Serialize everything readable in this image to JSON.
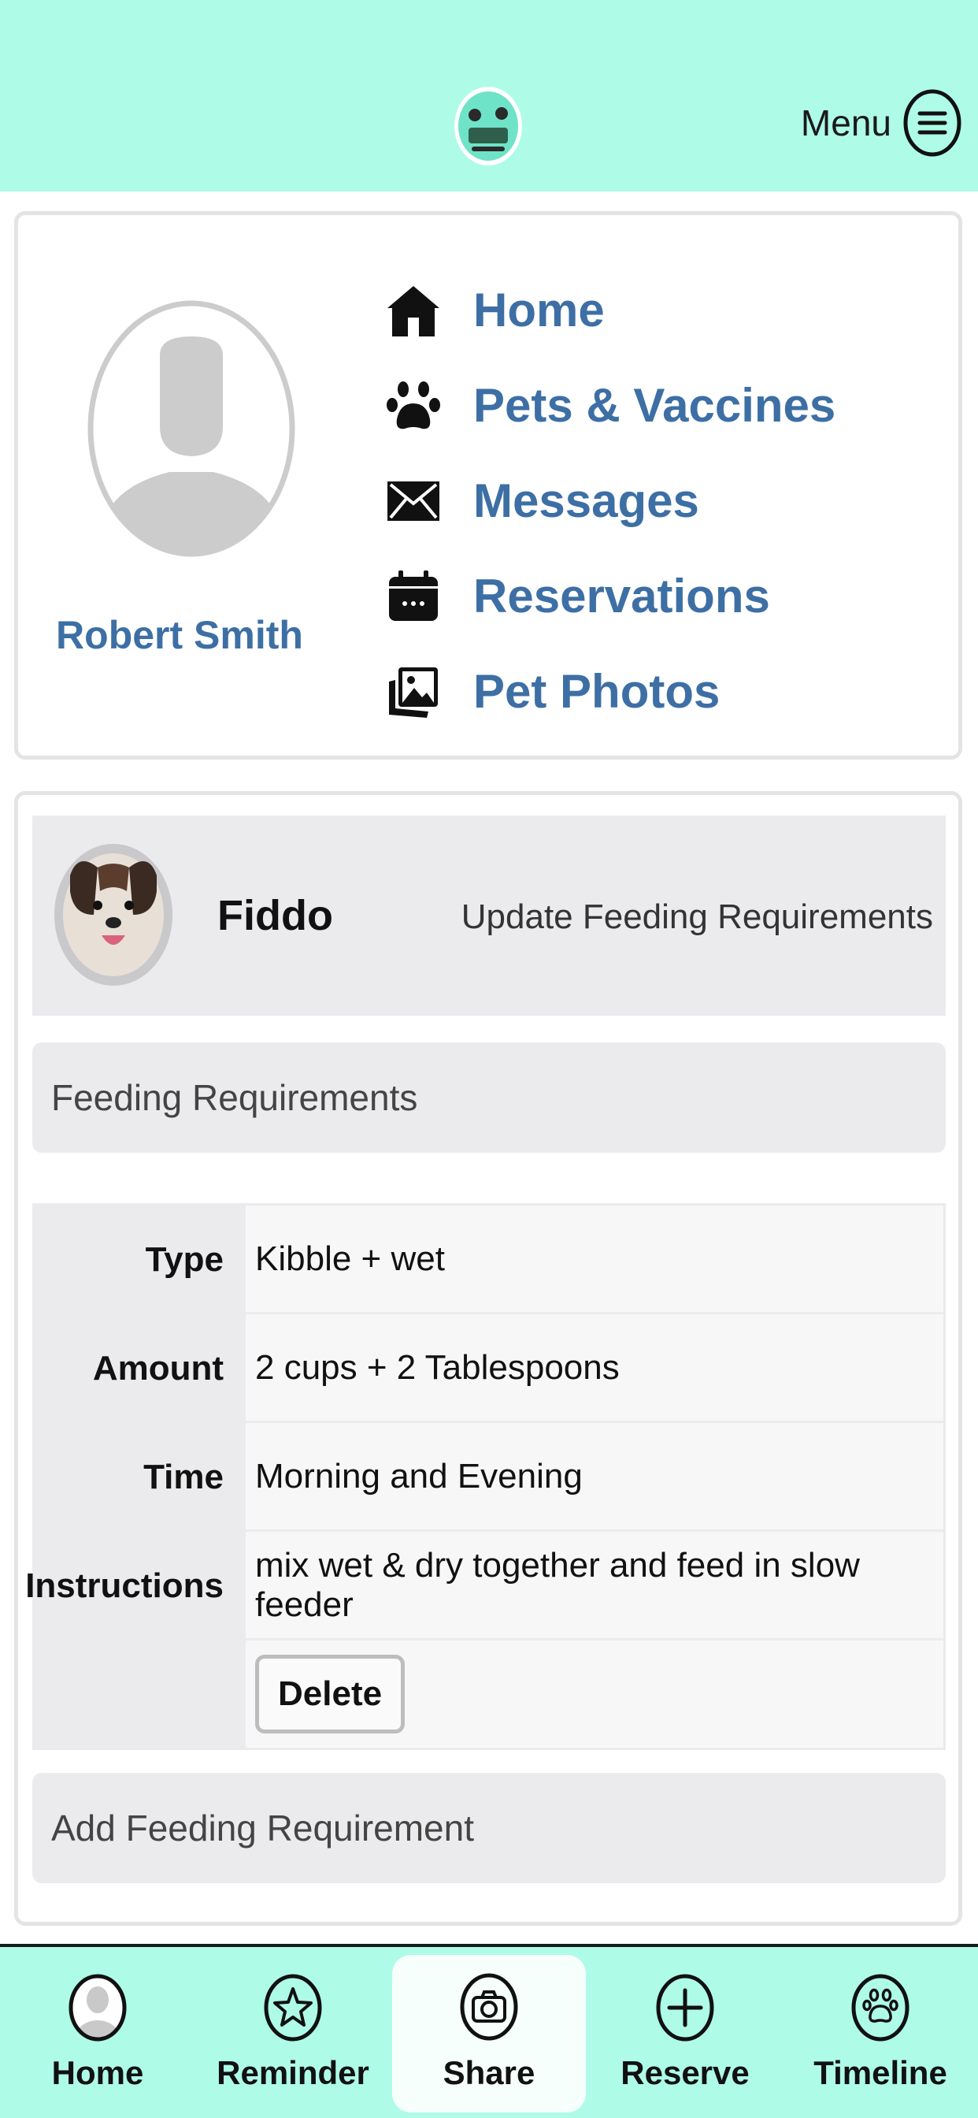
{
  "header": {
    "menu_label": "Menu",
    "logo_icon": "pet-logo-icon"
  },
  "profile": {
    "user_name": "Robert Smith",
    "nav": [
      {
        "label": "Home",
        "icon": "house-icon"
      },
      {
        "label": "Pets & Vaccines",
        "icon": "paw-icon"
      },
      {
        "label": "Messages",
        "icon": "envelope-icon"
      },
      {
        "label": "Reservations",
        "icon": "calendar-icon"
      },
      {
        "label": "Pet Photos",
        "icon": "photos-icon"
      }
    ]
  },
  "pet": {
    "name": "Fiddo",
    "update_link": "Update Feeding Requirements"
  },
  "feeding": {
    "title": "Feeding Requirements",
    "rows": [
      {
        "label": "Type",
        "value": "Kibble + wet"
      },
      {
        "label": "Amount",
        "value": "2 cups + 2 Tablespoons"
      },
      {
        "label": "Time",
        "value": "Morning and Evening"
      },
      {
        "label": "Instructions",
        "value": "mix wet & dry together and feed in slow feeder"
      }
    ],
    "delete_label": "Delete",
    "add_label": "Add Feeding Requirement"
  },
  "bottom_nav": {
    "items": [
      {
        "label": "Home",
        "icon": "person-icon"
      },
      {
        "label": "Reminder",
        "icon": "star-icon"
      },
      {
        "label": "Share",
        "icon": "camera-icon",
        "active": true
      },
      {
        "label": "Reserve",
        "icon": "plus-icon"
      },
      {
        "label": "Timeline",
        "icon": "paw-icon"
      }
    ]
  },
  "colors": {
    "header_bg": "#aefbe8",
    "link_blue": "#3d6fa5",
    "panel_gray": "#ebebee"
  }
}
